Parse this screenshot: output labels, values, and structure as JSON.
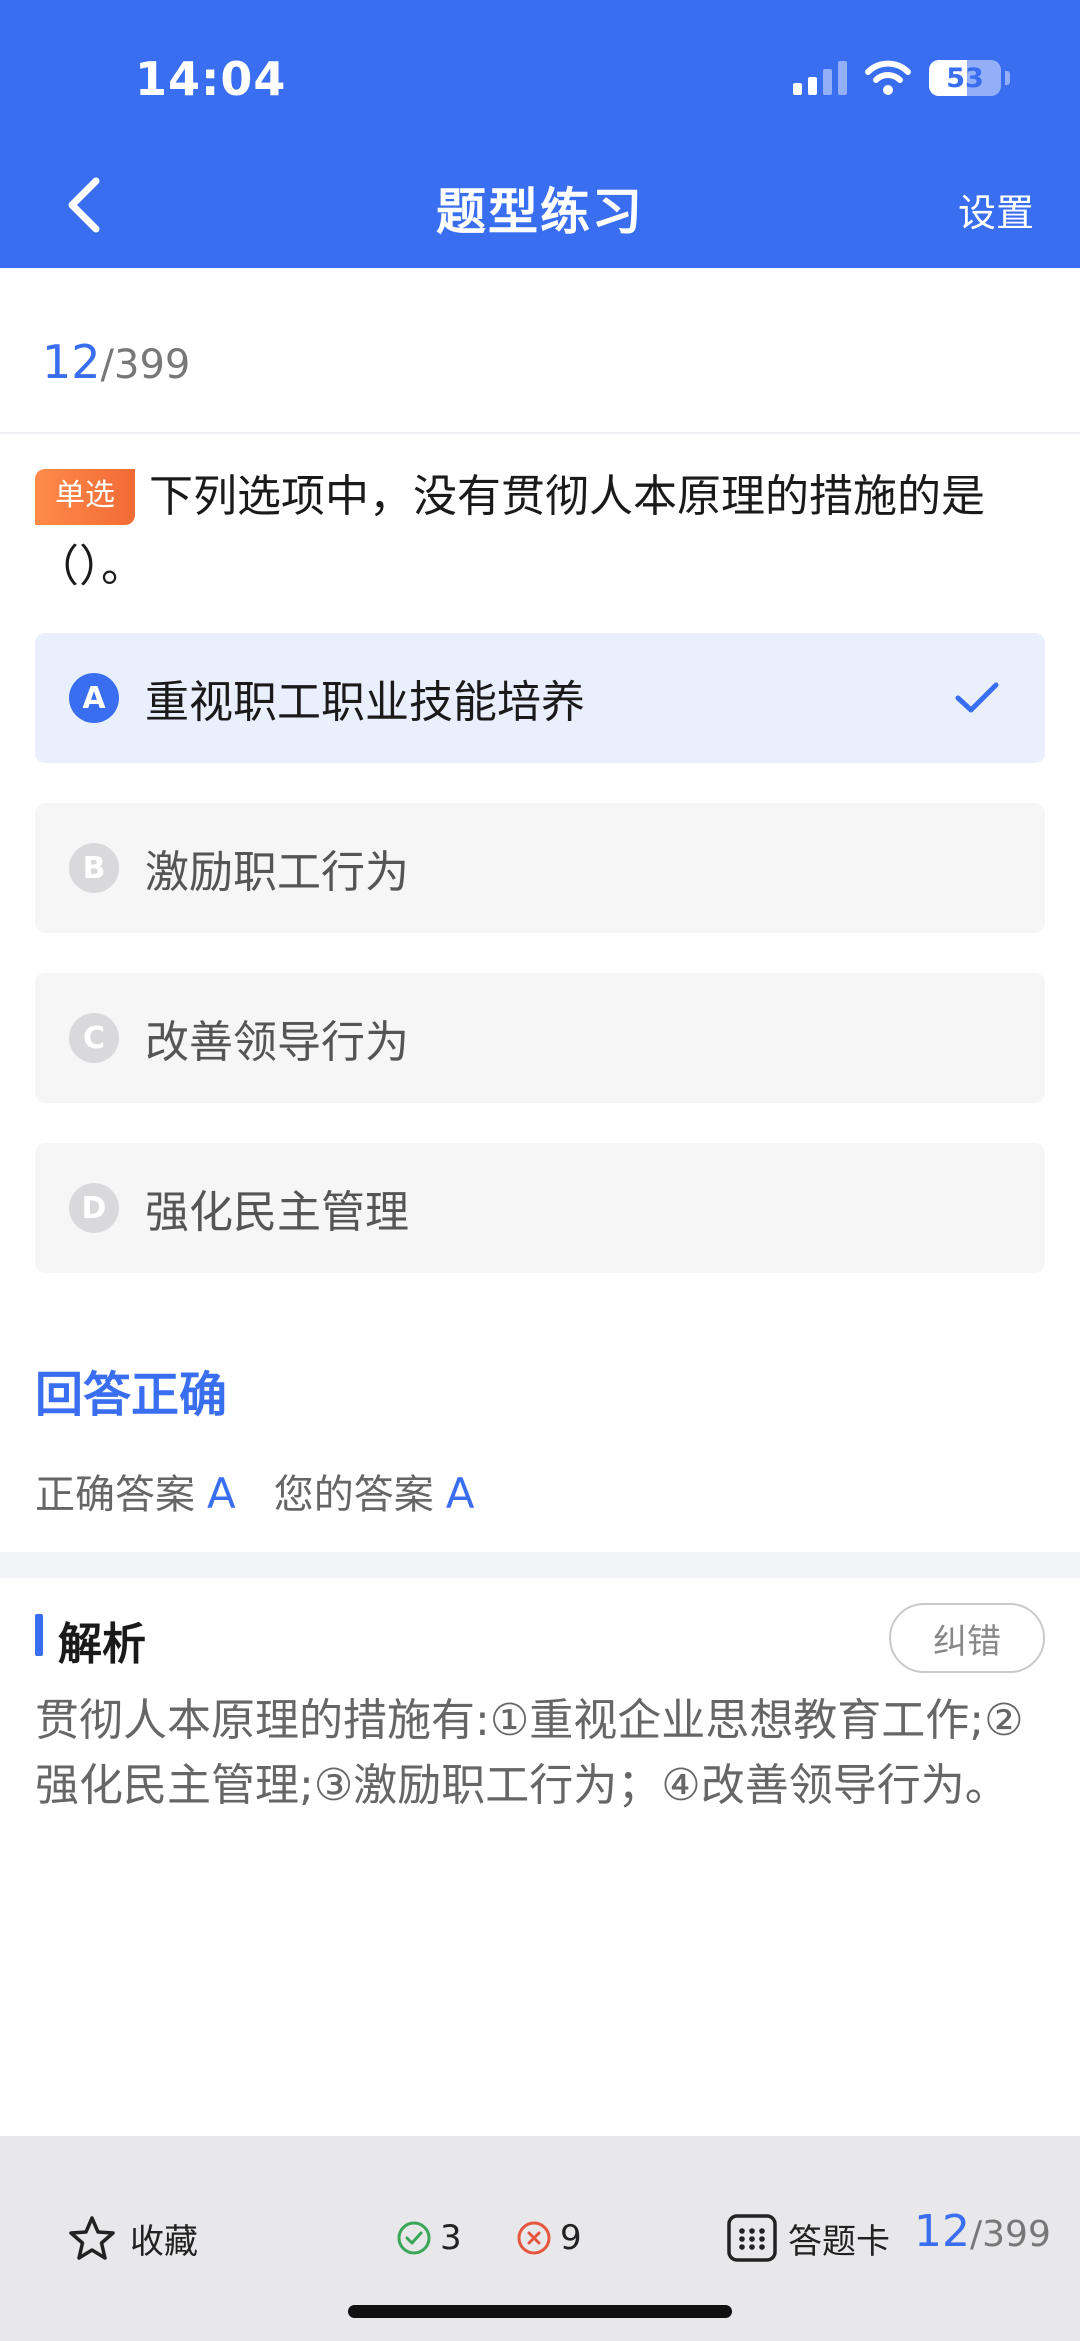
{
  "status_bar": {
    "time": "14:04",
    "battery": "53",
    "battery_level": 0.53
  },
  "header": {
    "title": "题型练习",
    "settings_label": "设置"
  },
  "progress": {
    "current": "12",
    "total": "/399"
  },
  "question": {
    "type_tag": "单选",
    "text": "下列选项中，没有贯彻人本原理的措施的是（）。"
  },
  "options": [
    {
      "letter": "A",
      "text": "重视职工职业技能培养",
      "selected": true
    },
    {
      "letter": "B",
      "text": "激励职工行为",
      "selected": false
    },
    {
      "letter": "C",
      "text": "改善领导行为",
      "selected": false
    },
    {
      "letter": "D",
      "text": "强化民主管理",
      "selected": false
    }
  ],
  "result": {
    "title": "回答正确",
    "correct_label": "正确答案",
    "correct_value": "A",
    "yours_label": "您的答案",
    "yours_value": "A"
  },
  "analysis": {
    "title": "解析",
    "report_label": "纠错",
    "text": "贯彻人本原理的措施有:①重视企业思想教育工作;②强化民主管理;③激励职工行为；④改善领导行为。"
  },
  "bottom_bar": {
    "favorite_label": "收藏",
    "right_count": "3",
    "wrong_count": "9",
    "card_label": "答题卡",
    "current": "12",
    "total": "/399"
  },
  "colors": {
    "accent": "#3a6ef1",
    "tag": "#f26b35",
    "right": "#3aa657",
    "wrong": "#e8553e"
  },
  "icons": [
    "back-arrow-icon",
    "signal-icon",
    "wifi-icon",
    "battery-icon",
    "check-icon",
    "star-icon",
    "check-circle-icon",
    "x-circle-icon",
    "grid-icon"
  ]
}
